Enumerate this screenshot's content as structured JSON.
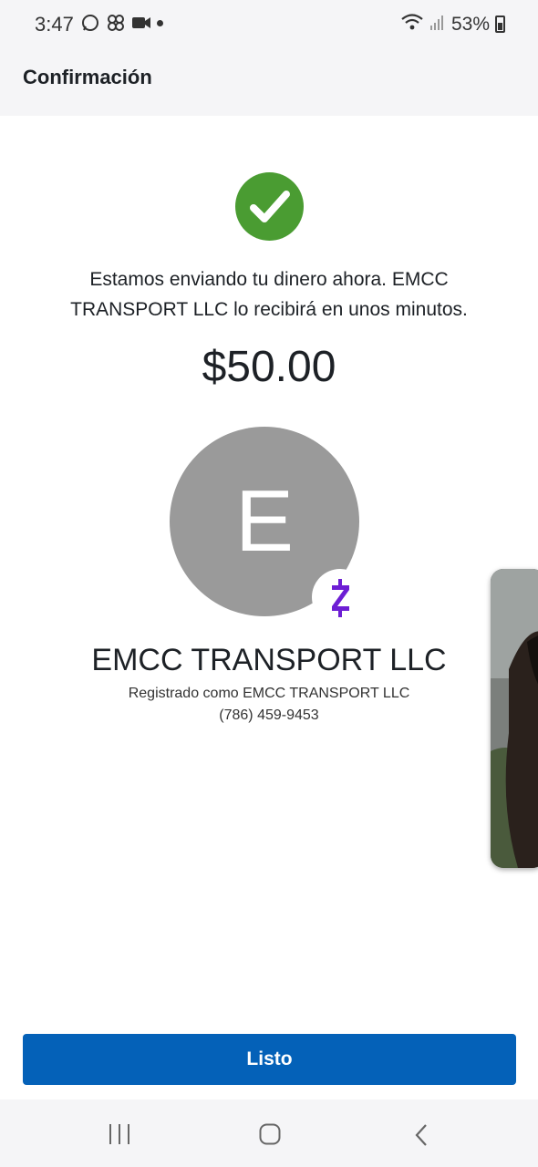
{
  "status_bar": {
    "time": "3:47",
    "battery": "53%"
  },
  "header": {
    "title": "Confirmación"
  },
  "confirmation": {
    "message": "Estamos enviando tu dinero ahora. EMCC TRANSPORT LLC lo recibirá en unos minutos.",
    "amount": "$50.00"
  },
  "recipient": {
    "avatar_initial": "E",
    "name": "EMCC TRANSPORT LLC",
    "registered_as": "Registrado como EMCC TRANSPORT LLC",
    "phone": "(786) 459-9453"
  },
  "actions": {
    "done_label": "Listo"
  },
  "icons": {
    "success": "check-circle-icon",
    "payment_brand": "zelle-icon"
  },
  "colors": {
    "success_green": "#4a9c32",
    "primary_blue": "#0461b8",
    "zelle_purple": "#6d1ed4",
    "avatar_gray": "#9a9a9a"
  }
}
